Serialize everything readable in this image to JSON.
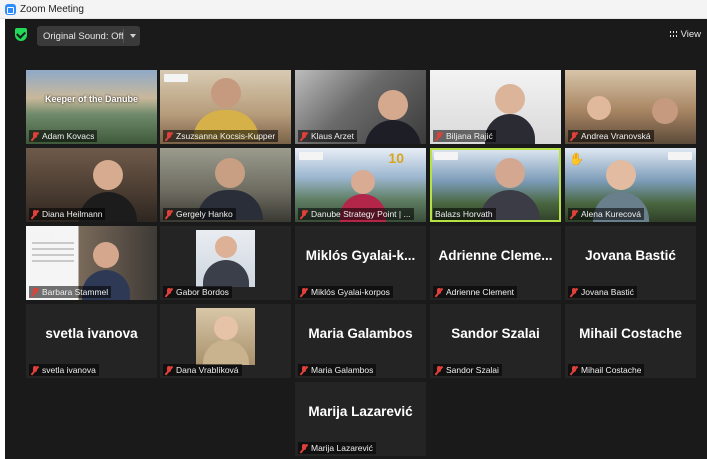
{
  "window": {
    "title": "Zoom Meeting"
  },
  "toolbar": {
    "sound_label": "Original Sound: Off",
    "view_label": "View"
  },
  "colors": {
    "accent_active": "#b7e243",
    "muted": "#e0403a",
    "shield": "#23d959",
    "background": "#1a1a1a"
  },
  "participants": [
    {
      "name": "Adam Kovacs",
      "overlay": "Keeper of the Danube"
    },
    {
      "name": "Zsuzsanna Kocsis-Kupper"
    },
    {
      "name": "Klaus Arzet"
    },
    {
      "name": "Biljana Rajić"
    },
    {
      "name": "Andrea Vranovská"
    },
    {
      "name": "Diana Heilmann"
    },
    {
      "name": "Gergely Hanko"
    },
    {
      "name": "Danube Strategy Point | ..."
    },
    {
      "name": "Balazs Horvath"
    },
    {
      "name": "Alena Kurecová"
    },
    {
      "name": "Barbara Stammel"
    },
    {
      "name": "Gabor Bordos"
    },
    {
      "name": "Miklós Gyalai-korpos",
      "big": "Miklós Gyalai-k..."
    },
    {
      "name": "Adrienne Clement",
      "big": "Adrienne Cleme..."
    },
    {
      "name": "Jovana Bastić",
      "big": "Jovana Bastić"
    },
    {
      "name": "svetla ivanova",
      "big": "svetla ivanova"
    },
    {
      "name": "Dana Vrablíková"
    },
    {
      "name": "Maria Galambos",
      "big": "Maria Galambos"
    },
    {
      "name": "Sandor Szalai",
      "big": "Sandor Szalai"
    },
    {
      "name": "Mihail Costache",
      "big": "Mihail Costache"
    },
    {
      "name": "Marija Lazarević",
      "big": "Marija Lazarević"
    }
  ]
}
